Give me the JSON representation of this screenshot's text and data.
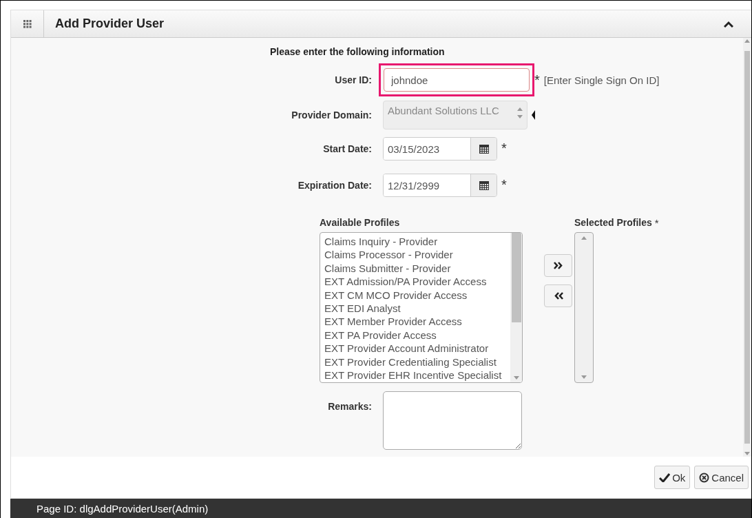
{
  "panel": {
    "title": "Add Provider User",
    "expanded": true
  },
  "intro": "Please enter the following information",
  "fields": [
    {
      "kind": "text",
      "label": "User ID:",
      "value": "johndoe",
      "required_mark": "*",
      "highlighted": true,
      "hint": "[Enter Single Sign On ID]"
    },
    {
      "kind": "select",
      "label": "Provider Domain:",
      "value": "Abundant Solutions LLC",
      "disabled": true
    },
    {
      "kind": "date",
      "label": "Start Date:",
      "value": "03/15/2023",
      "required_mark": "*"
    },
    {
      "kind": "date",
      "label": "Expiration Date:",
      "value": "12/31/2999",
      "required_mark": "*"
    }
  ],
  "available_profiles": {
    "label": "Available Profiles",
    "items": [
      "Claims Inquiry - Provider",
      "Claims Processor - Provider",
      "Claims Submitter - Provider",
      "EXT Admission/PA Provider Access",
      "EXT CM MCO Provider Access",
      "EXT EDI Analyst",
      "EXT Member Provider Access",
      "EXT PA Provider Access",
      "EXT Provider Account Administrator",
      "EXT Provider Credentialing Specialist",
      "EXT Provider EHR Incentive Specialist"
    ]
  },
  "selected_profiles": {
    "label": "Selected Profiles",
    "required_mark": "*"
  },
  "remarks": {
    "label": "Remarks:"
  },
  "buttons": [
    {
      "kind": "ok",
      "label": "Ok"
    },
    {
      "kind": "cancel",
      "label": "Cancel"
    }
  ],
  "footer": "Page ID: dlgAddProviderUser(Admin)"
}
